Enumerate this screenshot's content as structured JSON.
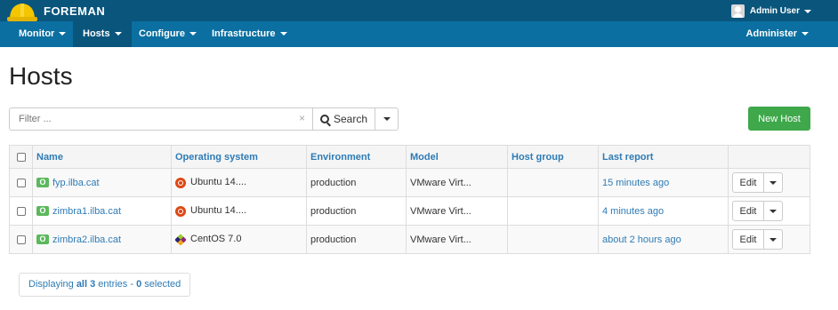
{
  "topbar": {
    "brand": "FOREMAN",
    "user": "Admin User"
  },
  "nav": {
    "items": [
      {
        "label": "Monitor"
      },
      {
        "label": "Hosts"
      },
      {
        "label": "Configure"
      },
      {
        "label": "Infrastructure"
      }
    ],
    "right": {
      "label": "Administer"
    }
  },
  "page": {
    "title": "Hosts"
  },
  "search": {
    "placeholder": "Filter ...",
    "button_label": "Search",
    "clear": "×"
  },
  "actions": {
    "new_host_label": "New Host"
  },
  "table": {
    "headers": {
      "name": "Name",
      "os": "Operating system",
      "environment": "Environment",
      "model": "Model",
      "hostgroup": "Host group",
      "last_report": "Last report"
    },
    "rows": [
      {
        "badge": "O",
        "name": "fyp.ilba.cat",
        "os_icon": "ubuntu-icon",
        "os": "Ubuntu 14....",
        "environment": "production",
        "model": "VMware Virt...",
        "hostgroup": "",
        "last_report": "15 minutes ago",
        "edit": "Edit"
      },
      {
        "badge": "O",
        "name": "zimbra1.ilba.cat",
        "os_icon": "ubuntu-icon",
        "os": "Ubuntu 14....",
        "environment": "production",
        "model": "VMware Virt...",
        "hostgroup": "",
        "last_report": "4 minutes ago",
        "edit": "Edit"
      },
      {
        "badge": "O",
        "name": "zimbra2.ilba.cat",
        "os_icon": "centos-icon",
        "os": "CentOS 7.0",
        "environment": "production",
        "model": "VMware Virt...",
        "hostgroup": "",
        "last_report": "about 2 hours ago",
        "edit": "Edit"
      }
    ]
  },
  "pagination": {
    "prefix": "Displaying ",
    "all_label": "all 3",
    "middle": " entries - ",
    "selected_count": "0",
    "suffix": " selected"
  },
  "colors": {
    "topbar": "#0a557c",
    "navbar": "#0b6fa1",
    "new_host": "#3fa84b",
    "link": "#2e7bb5",
    "status_ok": "#5cb85c"
  }
}
